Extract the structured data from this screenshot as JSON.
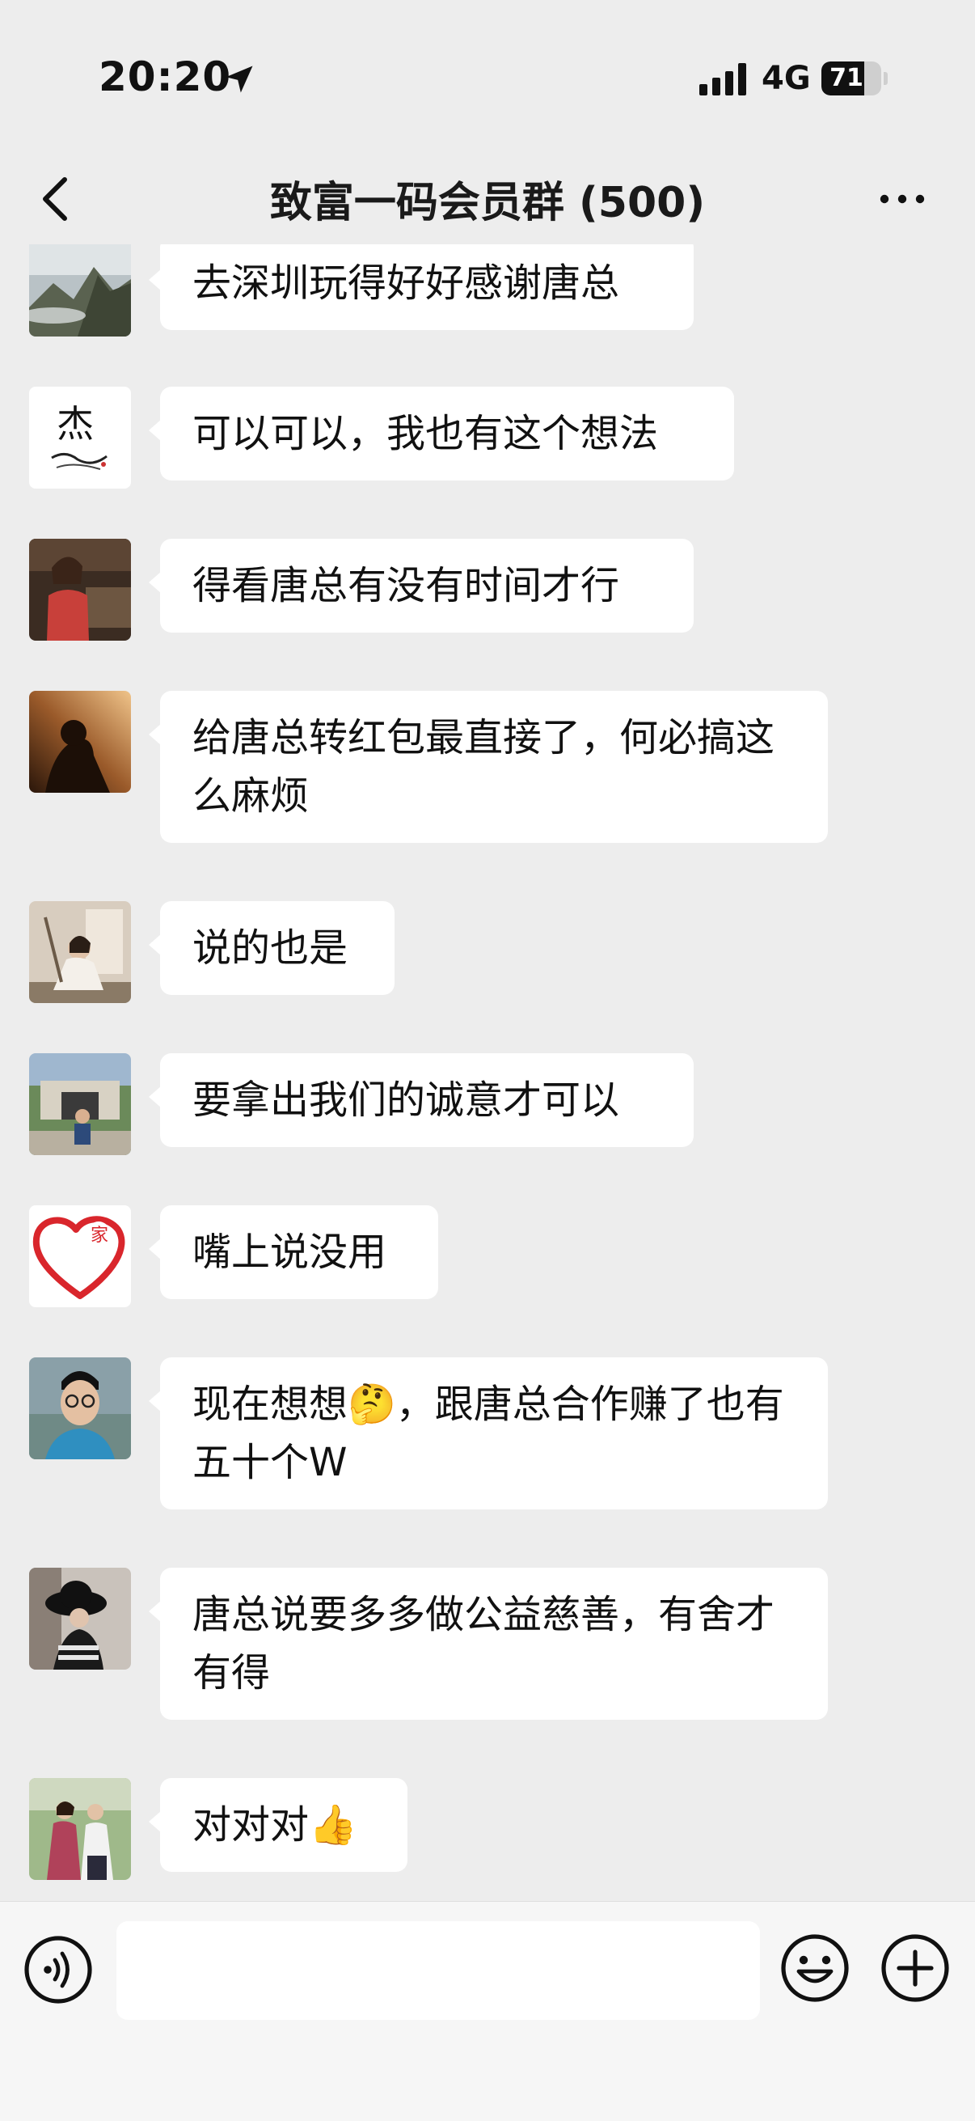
{
  "status": {
    "time": "20:20",
    "network": "4G",
    "battery": "71",
    "battery_fraction": 0.71
  },
  "nav": {
    "title": "致富一码会员群 (500)"
  },
  "messages": [
    {
      "text": "去深圳玩得好好感谢唐总"
    },
    {
      "text": "可以可以，我也有这个想法"
    },
    {
      "text": "得看唐总有没有时间才行"
    },
    {
      "text": "给唐总转红包最直接了，何必搞这么麻烦"
    },
    {
      "text": "说的也是"
    },
    {
      "text": "要拿出我们的诚意才可以"
    },
    {
      "text": "嘴上说没用"
    },
    {
      "text": "现在想想🤔，跟唐总合作赚了也有五十个W"
    },
    {
      "text": "唐总说要多多做公益慈善，有舍才有得"
    },
    {
      "text": "对对对👍"
    }
  ],
  "avatars": {
    "a1": {
      "icon": "mountain-fog-avatar"
    },
    "a2": {
      "icon": "calligraphy-jie-avatar",
      "glyph": "杰"
    },
    "a3": {
      "icon": "woman-restaurant-avatar"
    },
    "a4": {
      "icon": "silhouette-sunset-avatar"
    },
    "a5": {
      "icon": "woman-window-avatar"
    },
    "a6": {
      "icon": "man-gate-avatar"
    },
    "a7": {
      "icon": "red-heart-avatar",
      "glyph": "家"
    },
    "a8": {
      "icon": "man-glasses-avatar"
    },
    "a9": {
      "icon": "woman-hat-avatar"
    },
    "a10": {
      "icon": "couple-outdoor-avatar"
    }
  },
  "input": {
    "placeholder": ""
  },
  "colors": {
    "background": "#ededed",
    "bubble": "#ffffff",
    "input_bar": "#f6f6f6"
  }
}
